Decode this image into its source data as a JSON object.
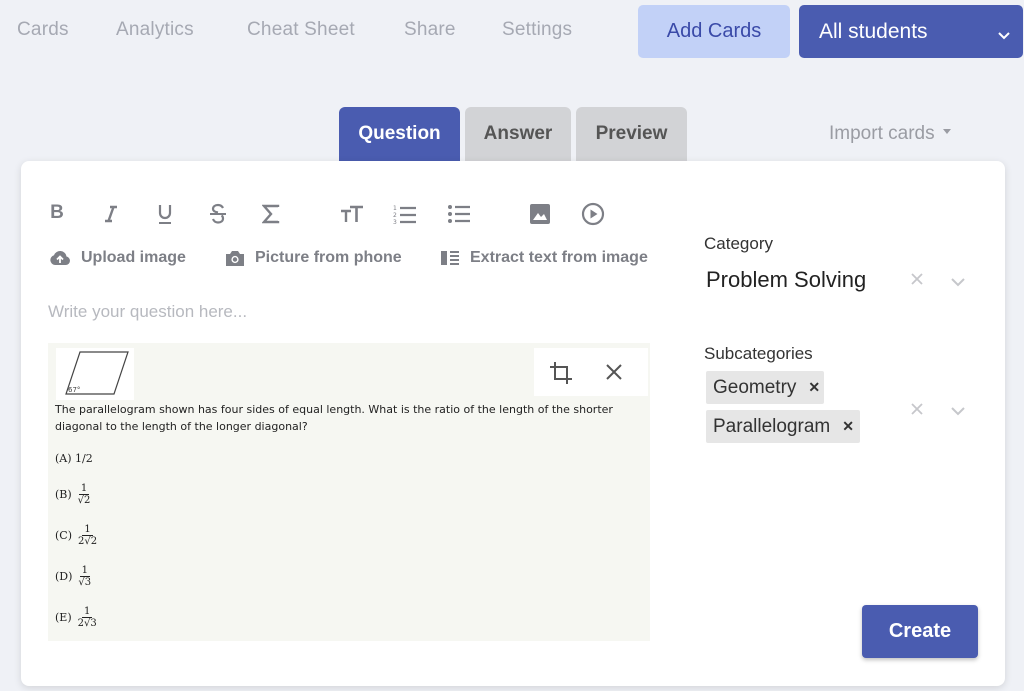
{
  "nav": {
    "items": [
      "Cards",
      "Analytics",
      "Cheat Sheet",
      "Share",
      "Settings"
    ],
    "add_cards": "Add Cards",
    "students": "All students"
  },
  "tabs": {
    "question": "Question",
    "answer": "Answer",
    "preview": "Preview"
  },
  "import_cards": "Import cards",
  "toolbar": {
    "bold": "B",
    "upload_image": "Upload image",
    "picture_from_phone": "Picture from phone",
    "extract_text": "Extract text from image"
  },
  "editor": {
    "placeholder": "Write your question here..."
  },
  "question_image": {
    "thumb_label": "67°",
    "text": "The parallelogram shown has four sides of equal length. What is the ratio of the length of the shorter diagonal to the length of the longer diagonal?",
    "options": [
      {
        "letter": "(A)",
        "plain": "1/2"
      },
      {
        "letter": "(B)",
        "num": "1",
        "den": "√2"
      },
      {
        "letter": "(C)",
        "num": "1",
        "den": "2√2"
      },
      {
        "letter": "(D)",
        "num": "1",
        "den": "√3"
      },
      {
        "letter": "(E)",
        "num": "1",
        "den": "2√3"
      }
    ]
  },
  "category": {
    "label": "Category",
    "value": "Problem Solving"
  },
  "subcategories": {
    "label": "Subcategories",
    "chips": [
      "Geometry",
      "Parallelogram"
    ]
  },
  "create": "Create",
  "colors": {
    "primary": "#4a5cb0",
    "accent_light": "#c2d1f7"
  }
}
